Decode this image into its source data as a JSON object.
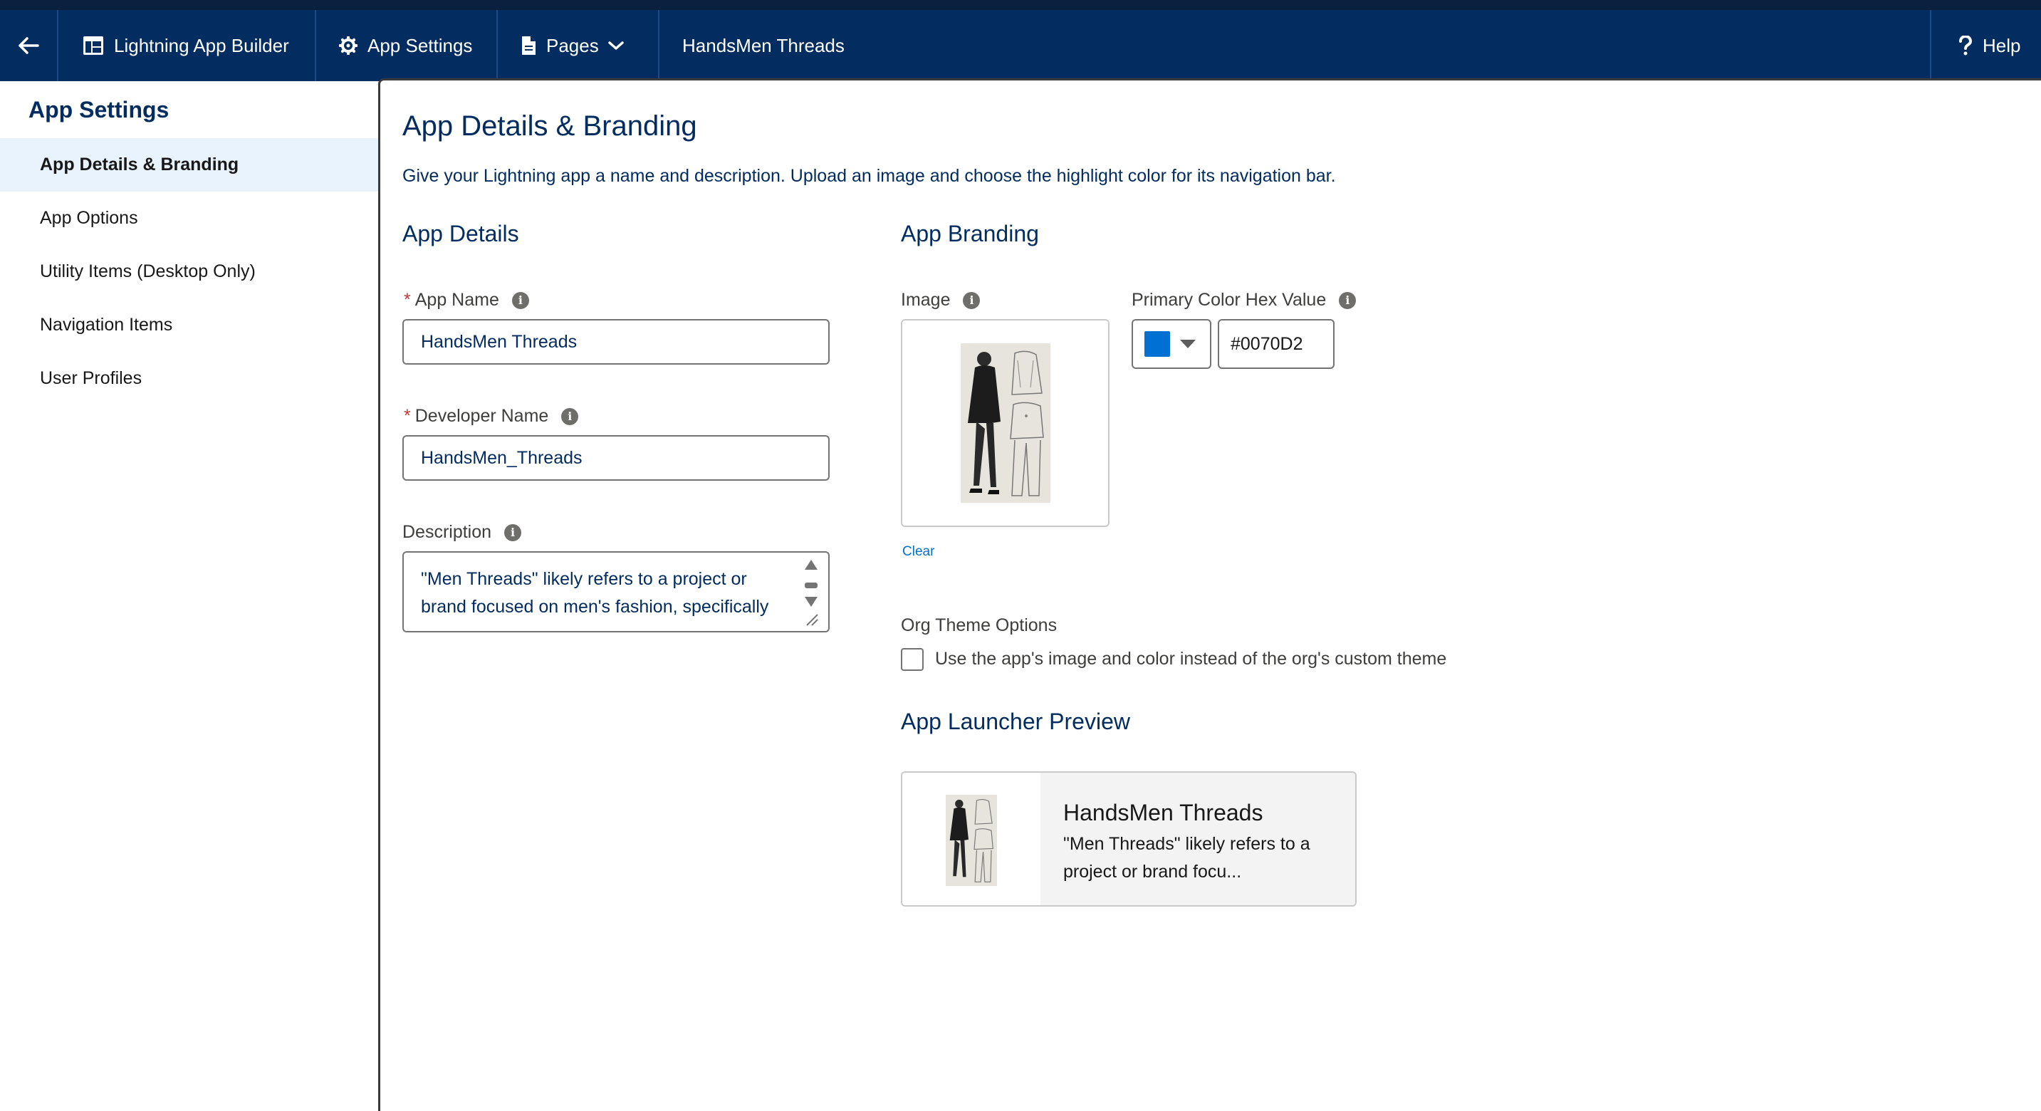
{
  "topbar": {
    "back_icon": "arrow-left-icon",
    "builder_label": "Lightning App Builder",
    "settings_label": "App Settings",
    "pages_label": "Pages",
    "app_title": "HandsMen Threads",
    "help_label": "Help"
  },
  "sidebar": {
    "title": "App Settings",
    "items": [
      {
        "label": "App Details & Branding",
        "active": true
      },
      {
        "label": "App Options"
      },
      {
        "label": "Utility Items (Desktop Only)"
      },
      {
        "label": "Navigation Items"
      },
      {
        "label": "User Profiles"
      }
    ]
  },
  "main": {
    "title": "App Details & Branding",
    "description": "Give your Lightning app a name and description. Upload an image and choose the highlight color for its navigation bar.",
    "details": {
      "heading": "App Details",
      "app_name_label": "App Name",
      "app_name_value": "HandsMen Threads",
      "developer_name_label": "Developer Name",
      "developer_name_value": "HandsMen_Threads",
      "description_label": "Description",
      "description_line1": "\"Men Threads\" likely refers to a project or",
      "description_line2": "brand focused on men's fashion, specifically"
    },
    "branding": {
      "heading": "App Branding",
      "image_label": "Image",
      "clear_label": "Clear",
      "color_label": "Primary Color Hex Value",
      "color_hex": "#0070D2",
      "swatch_color": "#0070d2",
      "org_theme_label": "Org Theme Options",
      "org_theme_checkbox_label": "Use the app's image and color instead of the org's custom theme"
    },
    "preview": {
      "heading": "App Launcher Preview",
      "app_name": "HandsMen Threads",
      "line1": "\"Men Threads\" likely refers to a",
      "line2": "project or brand focu..."
    }
  }
}
